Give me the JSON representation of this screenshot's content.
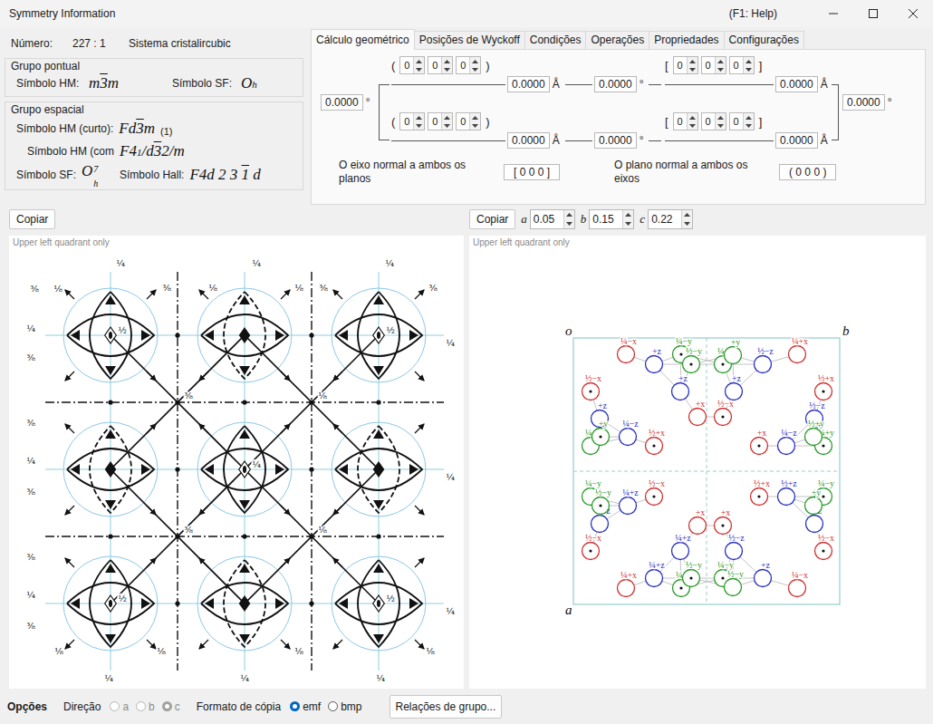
{
  "window": {
    "title": "Symmetry Information",
    "help": "(F1: Help)"
  },
  "info": {
    "number": {
      "label": "Número:",
      "value": "227 : 1"
    },
    "system": {
      "label": "Sistema cristalir",
      "value": "cubic"
    },
    "point_group": {
      "title": "Grupo pontual",
      "hm": {
        "label": "Símbolo HM:",
        "parts": [
          {
            "text": "m",
            "kind": "plain"
          },
          {
            "text": "3",
            "kind": "bar"
          },
          {
            "text": "m",
            "kind": "plain"
          }
        ]
      },
      "sf": {
        "label": "Símbolo SF:",
        "parts": [
          {
            "text": "O",
            "kind": "plain"
          },
          {
            "text": "h",
            "kind": "sub"
          }
        ]
      }
    },
    "space_group": {
      "title": "Grupo espacial",
      "hm_short": {
        "label": "Símbolo HM (curto):",
        "parts": [
          {
            "text": "Fd",
            "kind": "plain"
          },
          {
            "text": "3",
            "kind": "bar"
          },
          {
            "text": "m",
            "kind": "plain"
          }
        ],
        "note": "(1)"
      },
      "hm_full": {
        "label": "Símbolo HM (com",
        "parts": [
          {
            "text": "F4",
            "kind": "plain"
          },
          {
            "text": "1",
            "kind": "sub"
          },
          {
            "text": "/d",
            "kind": "plain"
          },
          {
            "text": "3",
            "kind": "bar"
          },
          {
            "text": "2/m",
            "kind": "plain"
          }
        ]
      },
      "sf": {
        "label": "Símbolo SF:",
        "parts": [
          {
            "text": "O",
            "kind": "plain"
          },
          {
            "text": "h",
            "sup": "7",
            "kind": "stack"
          }
        ]
      },
      "hall": {
        "label": "Símbolo Hall:",
        "parts": [
          {
            "text": "F4d 2 3 ",
            "kind": "plain"
          },
          {
            "text": "1",
            "kind": "bar"
          },
          {
            "text": " d",
            "kind": "plain"
          }
        ]
      }
    }
  },
  "tabs": [
    {
      "label": "Cálculo geométrico",
      "selected": true
    },
    {
      "label": "Posições de Wyckoff",
      "selected": false
    },
    {
      "label": "Condições",
      "selected": false
    },
    {
      "label": "Operações",
      "selected": false
    },
    {
      "label": "Propriedades",
      "selected": false
    },
    {
      "label": "Configurações",
      "selected": false
    }
  ],
  "geo": {
    "rows": [
      {
        "plane": {
          "open": "(",
          "values": [
            "0",
            "0",
            "0"
          ],
          "close": ")"
        },
        "plane_length": {
          "value": "0.0000",
          "unit": "Å"
        },
        "angle": {
          "value": "0.0000",
          "unit": "°"
        },
        "direction": {
          "open": "[",
          "values": [
            "0",
            "0",
            "0"
          ],
          "close": "]"
        },
        "dir_length": {
          "value": "0.0000",
          "unit": "Å"
        }
      },
      {
        "plane": {
          "open": "(",
          "values": [
            "0",
            "0",
            "0"
          ],
          "close": ")"
        },
        "plane_length": {
          "value": "0.0000",
          "unit": "Å"
        },
        "angle": {
          "value": "0.0000",
          "unit": "°"
        },
        "direction": {
          "open": "[",
          "values": [
            "0",
            "0",
            "0"
          ],
          "close": "]"
        },
        "dir_length": {
          "value": "0.0000",
          "unit": "Å"
        }
      }
    ],
    "left_angle": {
      "value": "0.0000",
      "unit": "°"
    },
    "right_angle": {
      "value": "0.0000",
      "unit": "°"
    },
    "normal_axis": {
      "label": "O eixo normal a ambos os planos",
      "value": "[ 0 0 0 ]"
    },
    "normal_plane": {
      "label": "O plano normal a ambos os eixos",
      "value": "( 0 0 0 )"
    }
  },
  "actions": {
    "left_copy": "Copiar",
    "right_copy": "Copiar",
    "params": [
      {
        "label": "a",
        "value": "0.05"
      },
      {
        "label": "b",
        "value": "0.15"
      },
      {
        "label": "c",
        "value": "0.22"
      }
    ]
  },
  "left_diagram": {
    "caption": "Upper left quadrant only",
    "fractions": [
      "⅜",
      "⅛",
      "¼",
      "⅜",
      "⅛",
      "¼",
      "⅛",
      "⅜",
      "¼",
      "⅜",
      "¼",
      "⅜",
      "⅜",
      "¼",
      "⅜",
      "⅜",
      "¼",
      "⅜",
      "¼",
      "¼",
      "¼",
      "⅛",
      "¼",
      "⅛",
      "¼",
      "⅛",
      "¼",
      "⅛",
      "½",
      "½",
      "¼",
      "½",
      "½",
      "⅜",
      "⅛",
      "⅜",
      "⅛"
    ]
  },
  "right_diagram": {
    "caption": "Upper left quadrant only",
    "axes": {
      "origin": "o",
      "b": "b",
      "a": "a"
    },
    "atoms": [
      {
        "label": "¼−x",
        "color": "#d03030",
        "dot": false
      },
      {
        "label": "¼−y",
        "color": "#2a9a2a",
        "dot": true
      },
      {
        "label": "½−y",
        "color": "#2a9a2a",
        "dot": true
      },
      {
        "label": "+z",
        "color": "#2830c0",
        "dot": false
      },
      {
        "label": "+z",
        "color": "#2830c0",
        "dot": false
      },
      {
        "label": "½−x",
        "color": "#d03030",
        "dot": true
      },
      {
        "label": "+x",
        "color": "#d03030",
        "dot": false
      },
      {
        "label": "+z",
        "color": "#2830c0",
        "dot": false
      },
      {
        "label": "¼+y",
        "color": "#2a9a2a",
        "dot": false
      },
      {
        "label": "+y",
        "color": "#2a9a2a",
        "dot": true
      },
      {
        "label": "¼−z",
        "color": "#2830c0",
        "dot": false
      },
      {
        "label": "½+x",
        "color": "#d03030",
        "dot": true
      },
      {
        "label": "¼+y",
        "color": "#2a9a2a",
        "dot": true
      },
      {
        "label": "+y",
        "color": "#2a9a2a",
        "dot": false
      },
      {
        "label": "¼+x",
        "color": "#d03030",
        "dot": false
      },
      {
        "label": "½−z",
        "color": "#2830c0",
        "dot": false
      },
      {
        "label": "+z",
        "color": "#2830c0",
        "dot": false
      },
      {
        "label": "½+x",
        "color": "#d03030",
        "dot": true
      },
      {
        "label": "½−x",
        "color": "#d03030",
        "dot": true
      },
      {
        "label": "½−z",
        "color": "#2830c0",
        "dot": false
      },
      {
        "label": "¼−z",
        "color": "#2830c0",
        "dot": false
      },
      {
        "label": "+x",
        "color": "#d03030",
        "dot": true
      },
      {
        "label": "¼+y",
        "color": "#2a9a2a",
        "dot": true
      },
      {
        "label": "½+y",
        "color": "#2a9a2a",
        "dot": false
      },
      {
        "label": "¼+x",
        "color": "#d03030",
        "dot": false
      },
      {
        "label": "¼+y",
        "color": "#2a9a2a",
        "dot": true
      },
      {
        "label": "½−y",
        "color": "#2a9a2a",
        "dot": true
      },
      {
        "label": "¼+z",
        "color": "#2830c0",
        "dot": false
      },
      {
        "label": "¼+z",
        "color": "#2830c0",
        "dot": false
      },
      {
        "label": "½−x",
        "color": "#d03030",
        "dot": true
      },
      {
        "label": "+x",
        "color": "#d03030",
        "dot": false
      },
      {
        "label": "¼−z",
        "color": "#2830c0",
        "dot": false
      },
      {
        "label": "¼−y",
        "color": "#2a9a2a",
        "dot": false
      },
      {
        "label": "½−y",
        "color": "#2a9a2a",
        "dot": true
      },
      {
        "label": "¼+z",
        "color": "#2830c0",
        "dot": false
      },
      {
        "label": "½−x",
        "color": "#d03030",
        "dot": true
      },
      {
        "label": "¼−y",
        "color": "#2a9a2a",
        "dot": true
      },
      {
        "label": "½−y",
        "color": "#2a9a2a",
        "dot": false
      },
      {
        "label": "¼−x",
        "color": "#d03030",
        "dot": false
      },
      {
        "label": "+z",
        "color": "#2830c0",
        "dot": false
      },
      {
        "label": "½−z",
        "color": "#2830c0",
        "dot": false
      },
      {
        "label": "½−x",
        "color": "#d03030",
        "dot": true
      },
      {
        "label": "+x",
        "color": "#d03030",
        "dot": true
      },
      {
        "label": "+z",
        "color": "#2830c0",
        "dot": false
      },
      {
        "label": "½+z",
        "color": "#2830c0",
        "dot": false
      },
      {
        "label": "½+x",
        "color": "#d03030",
        "dot": true
      },
      {
        "label": "¼−y",
        "color": "#2a9a2a",
        "dot": true
      },
      {
        "label": "+y",
        "color": "#2a9a2a",
        "dot": false
      }
    ]
  },
  "options": {
    "title": "Opções",
    "direction": {
      "label": "Direção",
      "choices": [
        {
          "label": "a",
          "selected": false,
          "disabled": true
        },
        {
          "label": "b",
          "selected": false,
          "disabled": true
        },
        {
          "label": "c",
          "selected": true,
          "disabled": true
        }
      ]
    },
    "copy_format": {
      "label": "Formato de cópia",
      "choices": [
        {
          "label": "emf",
          "selected": true,
          "disabled": false
        },
        {
          "label": "bmp",
          "selected": false,
          "disabled": false
        }
      ]
    },
    "button": "Relações de grupo..."
  }
}
